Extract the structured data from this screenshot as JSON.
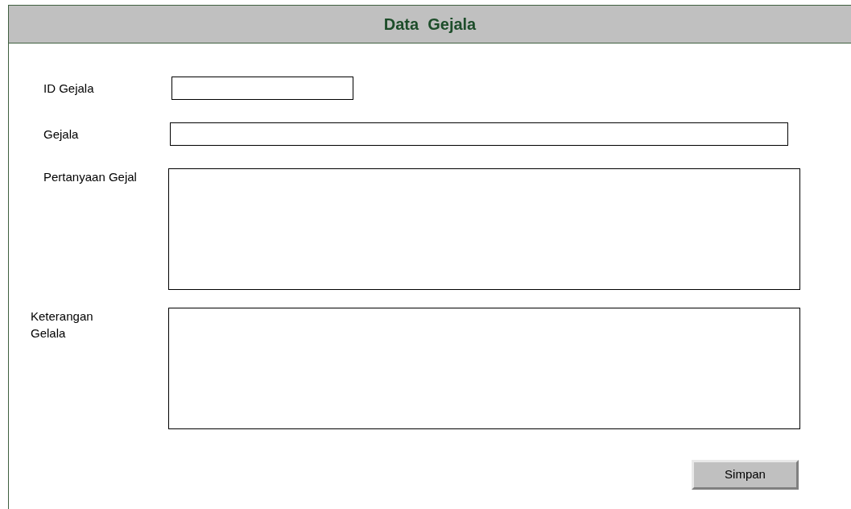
{
  "title": "Data  Gejala",
  "fields": [
    {
      "label": "ID Gejala",
      "kind": "short"
    },
    {
      "label": "Gejala",
      "kind": "long"
    },
    {
      "label": "Pertanyaan Gejal",
      "kind": "textarea"
    },
    {
      "label": "Keterangan Gelala",
      "kind": "textarea"
    }
  ],
  "button": "Simpan"
}
